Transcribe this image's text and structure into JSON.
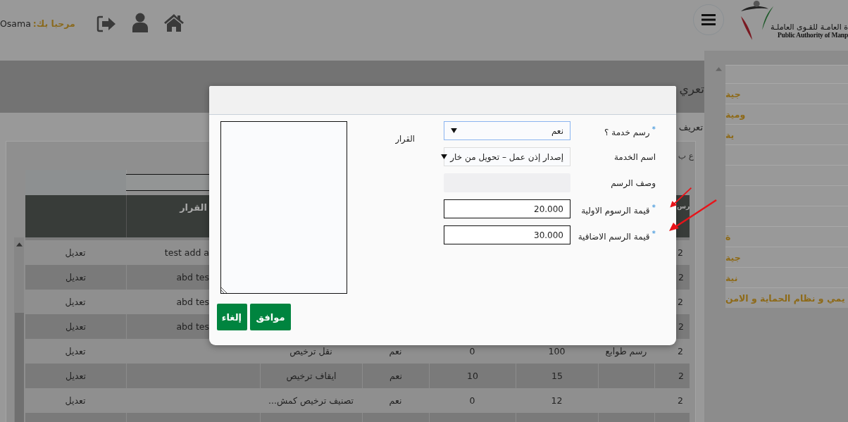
{
  "header": {
    "greeting_label": "مرحبا بك:",
    "user_name": "Osama",
    "logo_arabic": "ة العامـة للقـوى العاملـة",
    "logo_english": "Public Authority of Manp"
  },
  "page_title": "تعري",
  "breadcrumb": "تعريف",
  "sidebar": {
    "items": [
      {
        "kind": "blank"
      },
      {
        "kind": "link",
        "label": "جية"
      },
      {
        "kind": "link",
        "label": "ومية"
      },
      {
        "kind": "link",
        "label": "ية"
      },
      {
        "kind": "blank"
      },
      {
        "kind": "blank"
      },
      {
        "kind": "blank"
      },
      {
        "kind": "blank"
      },
      {
        "kind": "link",
        "label": "ة"
      },
      {
        "kind": "link",
        "label": "جية"
      },
      {
        "kind": "link",
        "label": "نية"
      },
      {
        "kind": "link",
        "label": "يمي و نظام الحماية و الامن"
      }
    ]
  },
  "table": {
    "caption": "ع ب",
    "columns": [
      "رس",
      "",
      "",
      "",
      "",
      "",
      "القرار",
      ""
    ],
    "rows": [
      {
        "cells": [
          "2",
          null,
          null,
          null,
          null,
          null,
          "test add a",
          "تعديل"
        ]
      },
      {
        "cells": [
          "2",
          null,
          null,
          null,
          null,
          null,
          "abd tes",
          "تعديل"
        ]
      },
      {
        "cells": [
          "2",
          null,
          null,
          null,
          null,
          null,
          "abd tes",
          "تعديل"
        ]
      },
      {
        "cells": [
          "2",
          null,
          null,
          null,
          null,
          null,
          "abd tes",
          "تعديل"
        ]
      },
      {
        "cells": [
          "2",
          "رسم طوابع",
          "100",
          "0",
          "نعم",
          "نقل ترخيص",
          null,
          "تعديل"
        ]
      },
      {
        "cells": [
          "2",
          null,
          "15",
          "10",
          "نعم",
          "ايقاف ترخيص",
          null,
          "تعديل"
        ]
      },
      {
        "cells": [
          "2",
          null,
          "12",
          "0",
          "نعم",
          "تصنيف ترخيص كمش...",
          null,
          "تعديل"
        ]
      }
    ]
  },
  "dialog": {
    "fields": [
      {
        "kind": "select",
        "label": "رسم خدمة ؟",
        "mark": "*",
        "value": "نعم",
        "focused": true,
        "arrow": false
      },
      {
        "kind": "select",
        "label": "اسم الخدمة",
        "value": "إصدار إذن عمل – تحويل من خار",
        "focused": false,
        "arrow": false
      },
      {
        "kind": "readonly",
        "label": "وصف الرسم",
        "arrow": false
      },
      {
        "kind": "input",
        "label": "قيمة الرسوم الاولية",
        "mark": "*",
        "value": "20.000",
        "arrow": true
      },
      {
        "kind": "input",
        "label": "قيمة الرسم الاضافية",
        "mark": "*",
        "value": "30.000",
        "arrow": true
      }
    ],
    "decision": {
      "label": "القرار"
    },
    "buttons": [
      {
        "label": "موافق"
      },
      {
        "label": "إلغاء"
      }
    ]
  }
}
